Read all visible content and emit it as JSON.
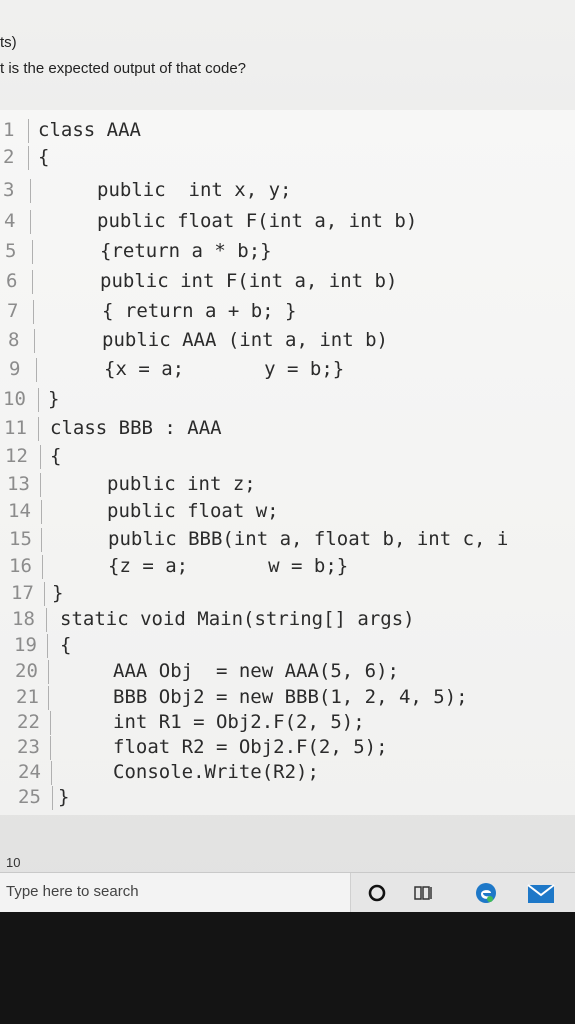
{
  "question": {
    "marks": "ts)",
    "prompt": "t is the expected output of that code?"
  },
  "code_lines": [
    {
      "num": "1",
      "text": "class AAA"
    },
    {
      "num": "2",
      "text": "{"
    },
    {
      "num": "3",
      "text": "public  int x, y;"
    },
    {
      "num": "4",
      "text": "public float F(int a, int b)"
    },
    {
      "num": "5",
      "text": "{return a * b;}"
    },
    {
      "num": "6",
      "text": "public int F(int a, int b)"
    },
    {
      "num": "7",
      "text": "{ return a + b; }"
    },
    {
      "num": "8",
      "text": "public AAA (int a, int b)"
    },
    {
      "num": "9",
      "text": "{x = a;       y = b;}"
    },
    {
      "num": "10",
      "text": "}"
    },
    {
      "num": "11",
      "text": "class BBB : AAA"
    },
    {
      "num": "12",
      "text": "{"
    },
    {
      "num": "13",
      "text": "public int z;"
    },
    {
      "num": "14",
      "text": "public float w;"
    },
    {
      "num": "15",
      "text": "public BBB(int a, float b, int c, i"
    },
    {
      "num": "16",
      "text": "{z = a;       w = b;}"
    },
    {
      "num": "17",
      "text": "}"
    },
    {
      "num": "18",
      "text": "static void Main(string[] args)"
    },
    {
      "num": "19",
      "text": "{"
    },
    {
      "num": "20",
      "text": "AAA Obj  = new AAA(5, 6);"
    },
    {
      "num": "21",
      "text": "BBB Obj2 = new BBB(1, 2, 4, 5);"
    },
    {
      "num": "22",
      "text": "int R1 = Obj2.F(2, 5);"
    },
    {
      "num": "23",
      "text": "float R2 = Obj2.F(2, 5);"
    },
    {
      "num": "24",
      "text": "Console.Write(R2);"
    },
    {
      "num": "25",
      "text": "}"
    }
  ],
  "page_number": "10",
  "taskbar": {
    "search_placeholder": "Type here to search",
    "icons": [
      "cortana-circle-icon",
      "task-view-icon",
      "edge-browser-icon",
      "mail-icon"
    ],
    "accent": "#1e78c8"
  }
}
